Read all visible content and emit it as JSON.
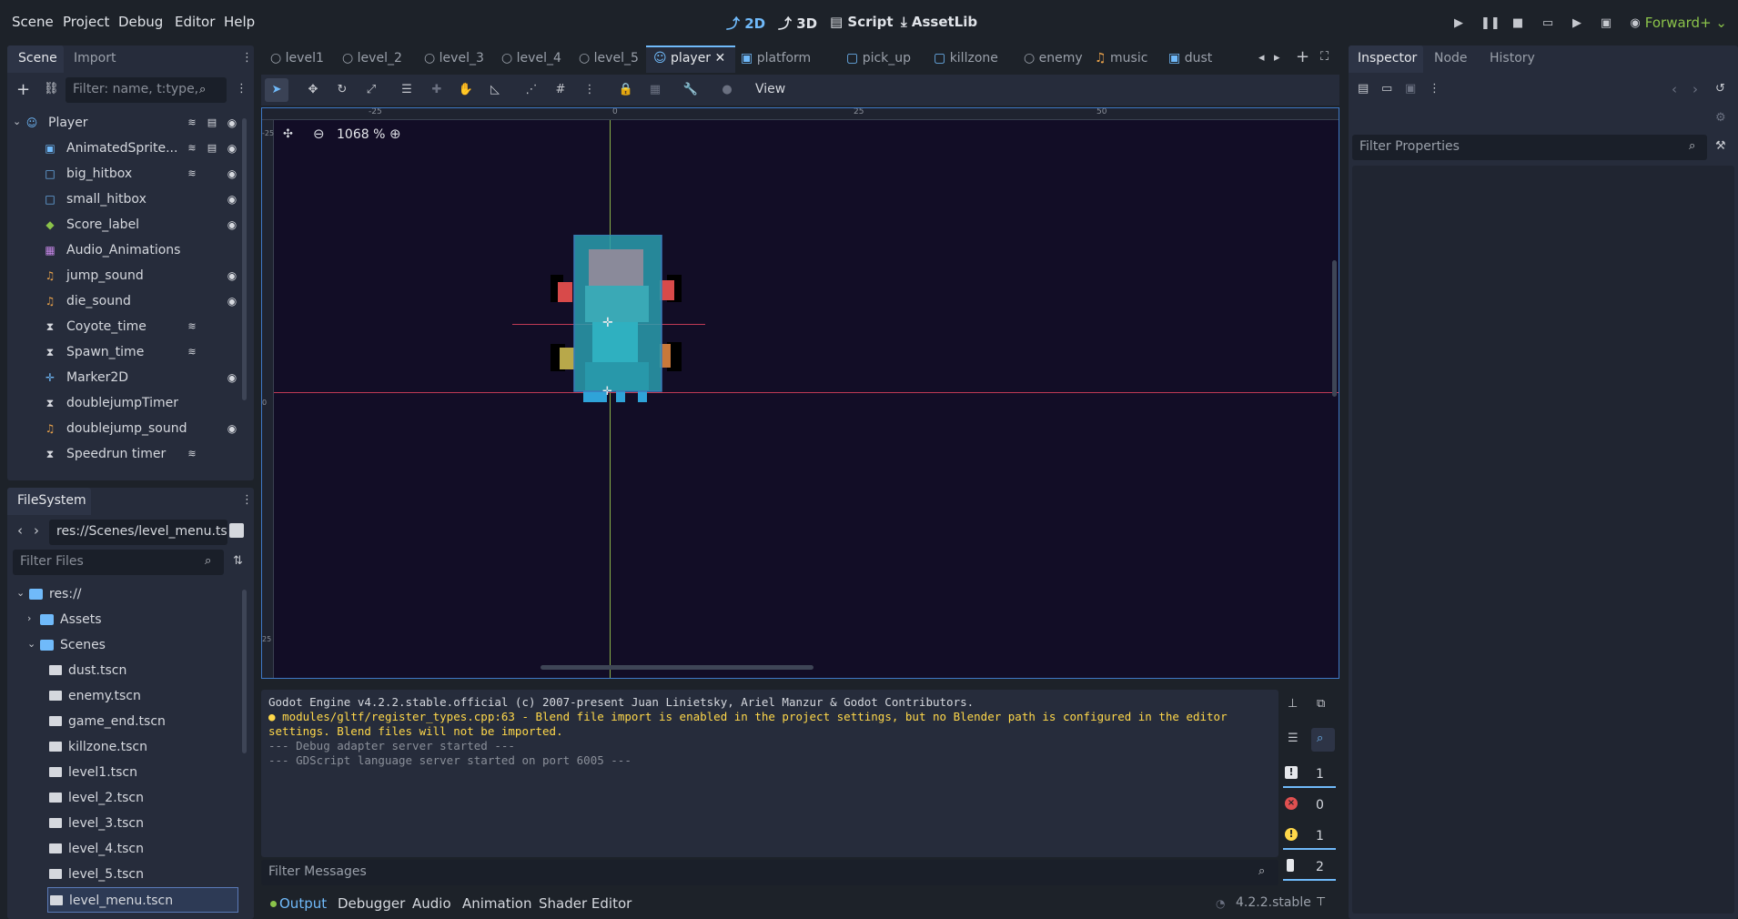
{
  "menu": [
    "Scene",
    "Project",
    "Debug",
    "Editor",
    "Help"
  ],
  "modes": {
    "m2d": "2D",
    "m3d": "3D",
    "script": "Script",
    "assetlib": "AssetLib"
  },
  "renderer": "Forward+",
  "scene_dock": {
    "tabs": [
      "Scene",
      "Import"
    ],
    "filter_placeholder": "Filter: name, t:type,",
    "nodes": [
      {
        "name": "Player",
        "icon": "character-body-icon",
        "root": true
      },
      {
        "name": "AnimatedSprite...",
        "icon": "animated-sprite-icon"
      },
      {
        "name": "big_hitbox",
        "icon": "area-icon"
      },
      {
        "name": "small_hitbox",
        "icon": "area-icon"
      },
      {
        "name": "Score_label",
        "icon": "label-icon"
      },
      {
        "name": "Audio_Animations",
        "icon": "animation-player-icon"
      },
      {
        "name": "jump_sound",
        "icon": "audio-icon"
      },
      {
        "name": "die_sound",
        "icon": "audio-icon"
      },
      {
        "name": "Coyote_time",
        "icon": "timer-icon"
      },
      {
        "name": "Spawn_time",
        "icon": "timer-icon"
      },
      {
        "name": "Marker2D",
        "icon": "marker-icon"
      },
      {
        "name": "doublejumpTimer",
        "icon": "timer-icon"
      },
      {
        "name": "doublejump_sound",
        "icon": "audio-icon"
      },
      {
        "name": "Speedrun timer",
        "icon": "timer-icon"
      }
    ]
  },
  "filesystem": {
    "title": "FileSystem",
    "path": "res://Scenes/level_menu.tsc",
    "filter_placeholder": "Filter Files",
    "root": "res://",
    "folders": [
      "Assets",
      "Scenes"
    ],
    "files": [
      "dust.tscn",
      "enemy.tscn",
      "game_end.tscn",
      "killzone.tscn",
      "level1.tscn",
      "level_2.tscn",
      "level_3.tscn",
      "level_4.tscn",
      "level_5.tscn",
      "level_menu.tscn"
    ]
  },
  "doc_tabs": [
    "level1",
    "level_2",
    "level_3",
    "level_4",
    "level_5",
    "player",
    "platform",
    "pick_up",
    "killzone",
    "enemy",
    "music",
    "dust"
  ],
  "active_doc": "player",
  "toolbar": {
    "view": "View"
  },
  "viewport": {
    "zoom": "1068 %",
    "ruler_labels": [
      "-25",
      "0",
      "25",
      "50"
    ],
    "vruler_labels": [
      "-25",
      "0",
      "25"
    ]
  },
  "output": {
    "lines": [
      {
        "text": "Godot Engine v4.2.2.stable.official (c) 2007-present Juan Linietsky, Ariel Manzur & Godot Contributors.",
        "kind": "info"
      },
      {
        "text": "modules/gltf/register_types.cpp:63 - Blend file import is enabled in the project settings, but no Blender path is configured in the editor",
        "kind": "warn"
      },
      {
        "text": "settings. Blend files will not be imported.",
        "kind": "warn"
      },
      {
        "text": "--- Debug adapter server started ---",
        "kind": "muted"
      },
      {
        "text": "--- GDScript language server started on port 6005 ---",
        "kind": "muted"
      }
    ],
    "filter_placeholder": "Filter Messages",
    "counts": {
      "messages": "1",
      "errors": "0",
      "warnings": "1",
      "info": "2"
    }
  },
  "bottom_tabs": [
    "Output",
    "Debugger",
    "Audio",
    "Animation",
    "Shader Editor"
  ],
  "version": "4.2.2.stable",
  "inspector": {
    "tabs": [
      "Inspector",
      "Node",
      "History"
    ],
    "filter_placeholder": "Filter Properties"
  },
  "colors": {
    "accent": "#70bafa",
    "warning": "#ffd84a",
    "error": "#e05050",
    "renderer": "#8bc34a",
    "viewport_bg": "#120d26"
  }
}
